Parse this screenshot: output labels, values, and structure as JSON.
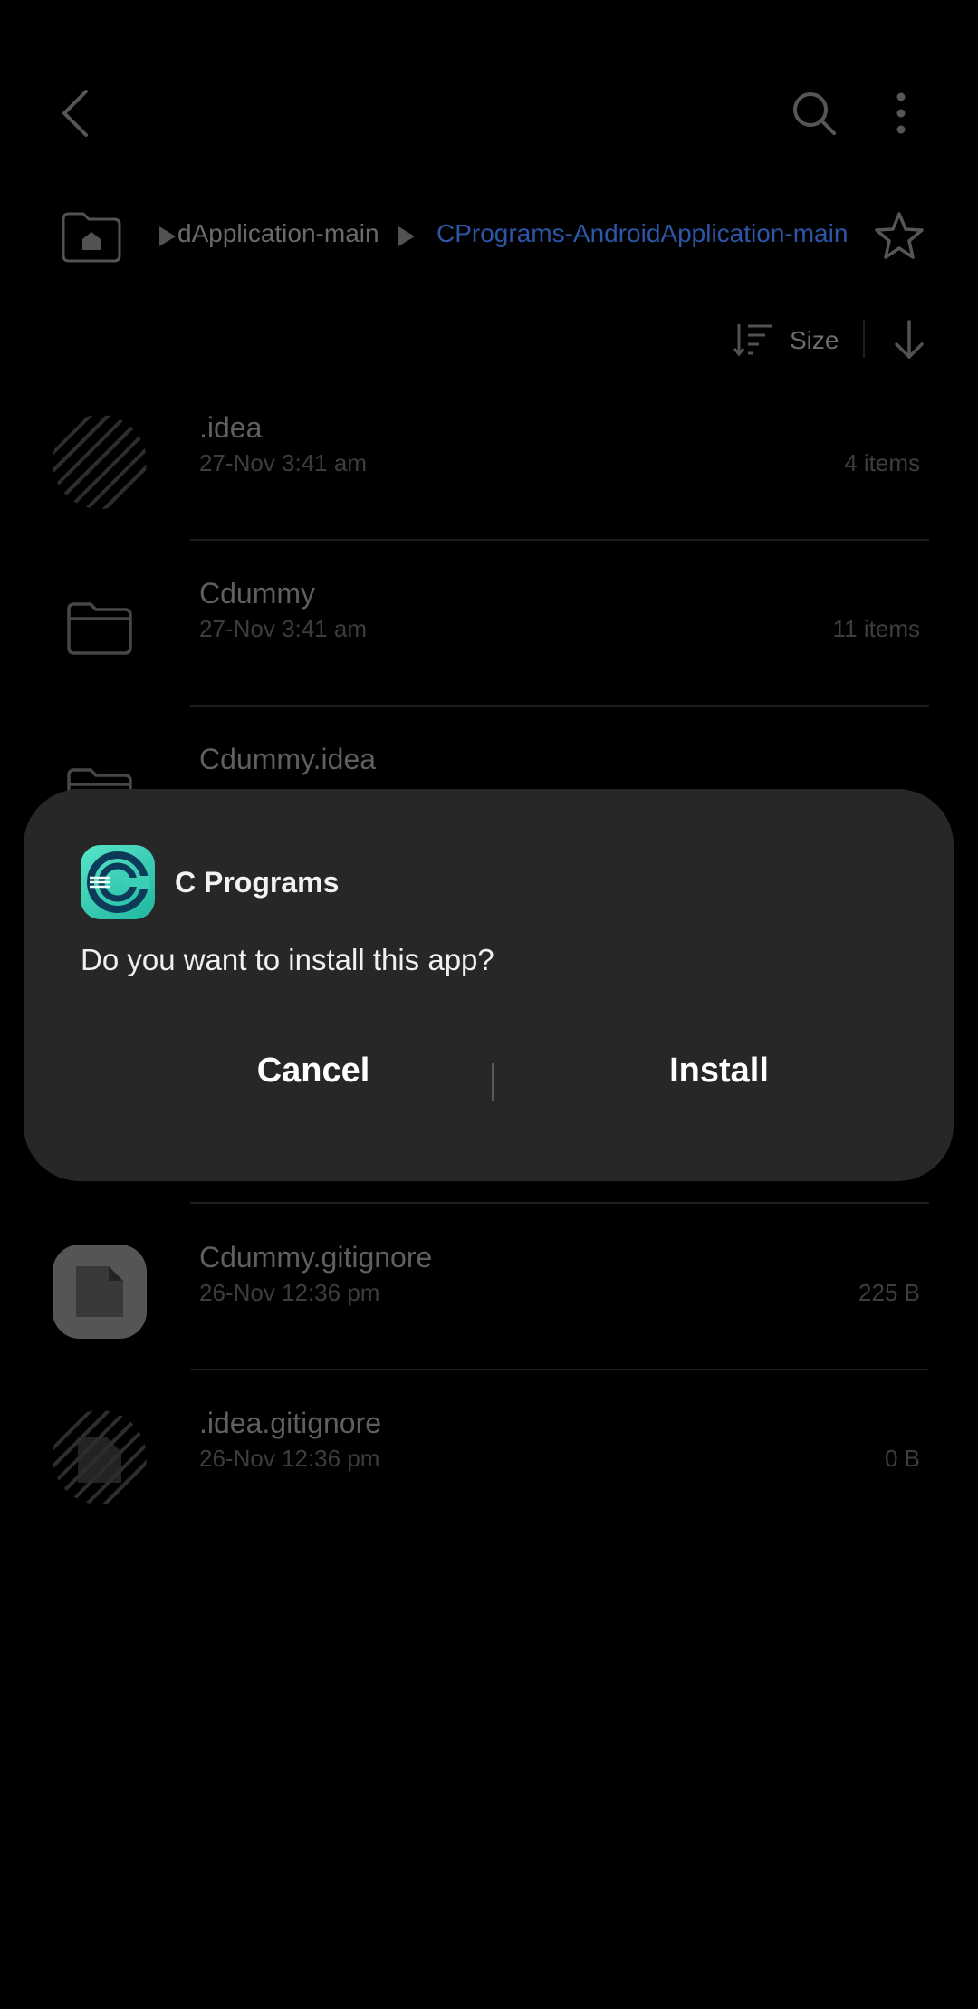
{
  "toolbar": {
    "back_icon": "chevron-left-icon",
    "search_icon": "search-icon",
    "more_icon": "more-vertical-icon"
  },
  "breadcrumb": {
    "home_icon": "home-folder-icon",
    "items": [
      {
        "label": "dApplication-main"
      },
      {
        "label": "CPrograms-AndroidApplication-main"
      }
    ],
    "favorite_icon": "star-outline-icon"
  },
  "sort": {
    "label": "Size",
    "sort_icon": "sort-lines-icon",
    "direction_icon": "arrow-down-icon"
  },
  "files": [
    {
      "name": ".idea",
      "date": "27-Nov 3:41 am",
      "meta": "4 items",
      "icon": "folder-hidden-icon"
    },
    {
      "name": "Cdummy",
      "date": "27-Nov 3:41 am",
      "meta": "11 items",
      "icon": "folder-icon"
    },
    {
      "name": "Cdummy.idea",
      "date": "",
      "meta": "",
      "icon": "folder-icon"
    },
    {
      "name": "Cdummy.gitignore",
      "date": "26-Nov 12:36 pm",
      "meta": "225 B",
      "icon": "file-icon"
    },
    {
      "name": ".idea.gitignore",
      "date": "26-Nov 12:36 pm",
      "meta": "0 B",
      "icon": "file-hidden-icon"
    }
  ],
  "dialog": {
    "app_name": "C Programs",
    "question": "Do you want to install this app?",
    "cancel_label": "Cancel",
    "install_label": "Install",
    "app_icon": "c-programs-app-icon",
    "accent_color": "#3ed3b6"
  }
}
